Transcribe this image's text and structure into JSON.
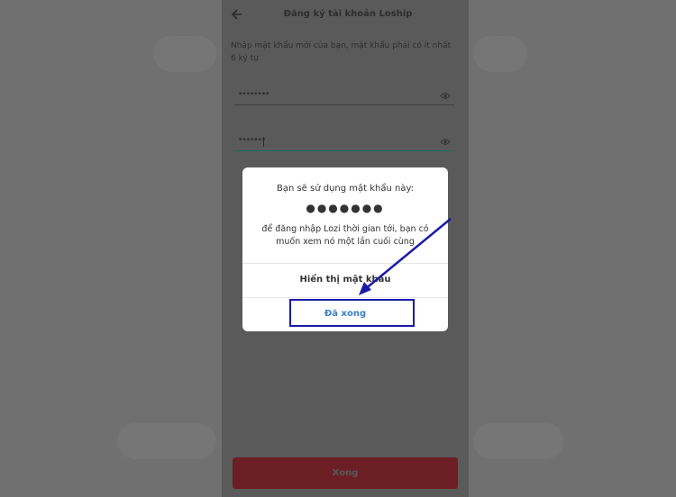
{
  "header": {
    "title": "Đăng ký tài khoản Loship",
    "back_icon": "back-arrow-icon"
  },
  "form": {
    "instruction": "Nhập mật khẩu mới của bạn, mật khẩu phải có ít nhất 6 ký tự",
    "password_value": "••••••••",
    "confirm_value": "•••••••",
    "eye_icon": "eye-icon",
    "submit_label": "Xong"
  },
  "dialog": {
    "line1": "Bạn sẽ sử dụng mật khẩu này:",
    "masked": "●●●●●●●",
    "line2": "để đăng nhập Lozi thời gian tới, bạn có muốn xem nó một lần cuối cùng",
    "show_label": "Hiển thị mật khẩu",
    "done_label": "Đã xong"
  },
  "colors": {
    "accent_button": "#6b1f24",
    "done_text": "#3d7fc4",
    "annotation": "#1a1aa8"
  }
}
